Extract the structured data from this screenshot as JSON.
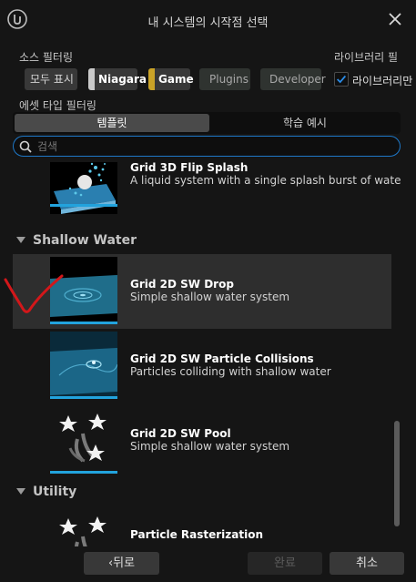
{
  "window": {
    "title": "내 시스템의 시작점 선택"
  },
  "source_filter": {
    "label": "소스 필터링",
    "chips": [
      {
        "label": "모두 표시",
        "color": null
      },
      {
        "label": "Niagara",
        "color": "#c9c9c9"
      },
      {
        "label": "Game",
        "color": "#c9a227"
      },
      {
        "label": "Plugins",
        "color": "#2e3a33"
      },
      {
        "label": "Developer",
        "color": "#2e3a33"
      }
    ]
  },
  "library": {
    "label": "라이브러리 필",
    "checkbox_label": "라이브러리만",
    "checked": true
  },
  "asset_type_filter": {
    "label": "에셋 타입 필터링",
    "tabs": [
      {
        "label": "템플릿",
        "active": true
      },
      {
        "label": "학습 예시",
        "active": false
      }
    ]
  },
  "search": {
    "placeholder": "검색",
    "value": ""
  },
  "list": {
    "items": [
      {
        "title": "Grid 3D Flip Splash",
        "desc": "A liquid system with a single splash burst of water",
        "icon": "splash-thumbnail"
      },
      {
        "category": "Shallow Water"
      },
      {
        "title": "Grid 2D SW Drop",
        "desc": "Simple shallow water system",
        "icon": "water-drop-thumbnail",
        "selected": true
      },
      {
        "title": "Grid 2D SW Particle Collisions",
        "desc": "Particles colliding with shallow water",
        "icon": "water-collision-thumbnail"
      },
      {
        "title": "Grid 2D SW Pool",
        "desc": "Simple shallow water system",
        "icon": "stars-icon"
      },
      {
        "category": "Utility"
      },
      {
        "title": "Particle Rasterization",
        "desc": "",
        "icon": "stars-icon"
      }
    ]
  },
  "buttons": {
    "back": "‹뒤로",
    "finish": "완료",
    "cancel": "취소"
  },
  "colors": {
    "accent": "#1e78c8",
    "thumb_underline": "#22a3dd",
    "annotation": "#d3171a"
  }
}
